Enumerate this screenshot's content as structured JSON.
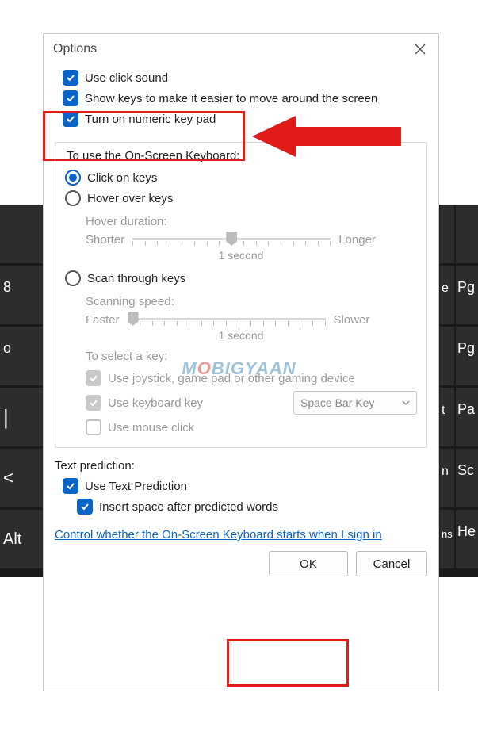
{
  "dialog": {
    "title": "Options",
    "close_icon": "close",
    "checkboxes": {
      "click_sound": "Use click sound",
      "show_keys": "Show keys to make it easier to move around the screen",
      "numeric_pad": "Turn on numeric key pad"
    },
    "group": {
      "title": "To use the On-Screen Keyboard:",
      "radio_click": "Click on keys",
      "radio_hover": "Hover over keys",
      "hover_duration_label": "Hover duration:",
      "shorter": "Shorter",
      "longer": "Longer",
      "hover_value": "1 second",
      "radio_scan": "Scan through keys",
      "scan_speed_label": "Scanning speed:",
      "faster": "Faster",
      "slower": "Slower",
      "scan_value": "1 second",
      "select_key_label": "To select a key:",
      "cb_joystick": "Use joystick, game pad or other gaming device",
      "cb_keyboard": "Use keyboard key",
      "keyboard_key_select": "Space Bar Key",
      "cb_mouse": "Use mouse click"
    },
    "textpred": {
      "title": "Text prediction:",
      "cb_use": "Use Text Prediction",
      "cb_insert": "Insert space after predicted words"
    },
    "link": "Control whether the On-Screen Keyboard starts when I sign in",
    "ok": "OK",
    "cancel": "Cancel"
  },
  "watermark": {
    "pre": "M",
    "o": "O",
    "post": "BIGYAAN"
  },
  "osk": {
    "right_keys": [
      "",
      "Pg",
      "Pg",
      "Pa",
      "Sc",
      "He"
    ],
    "left_col": [
      "",
      "8",
      "o",
      "|",
      "<",
      "Alt"
    ]
  }
}
